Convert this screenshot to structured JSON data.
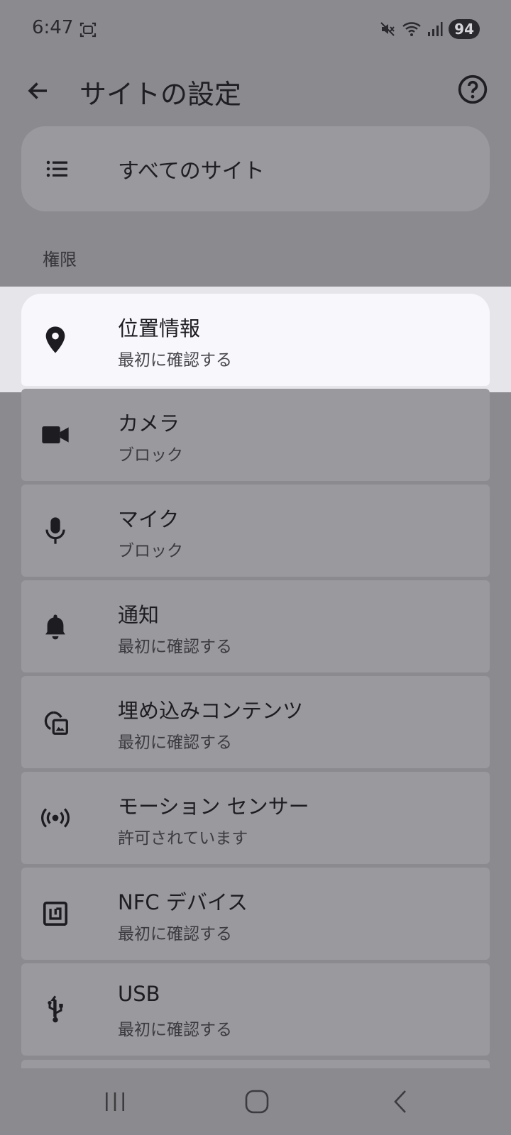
{
  "status_bar": {
    "time": "6:47",
    "battery": "94"
  },
  "app_bar": {
    "title": "サイトの設定"
  },
  "all_sites": {
    "label": "すべてのサイト"
  },
  "section": {
    "header": "権限"
  },
  "permissions": [
    {
      "title": "位置情報",
      "subtitle": "最初に確認する",
      "icon": "location-pin-icon"
    },
    {
      "title": "カメラ",
      "subtitle": "ブロック",
      "icon": "video-camera-icon"
    },
    {
      "title": "マイク",
      "subtitle": "ブロック",
      "icon": "microphone-icon"
    },
    {
      "title": "通知",
      "subtitle": "最初に確認する",
      "icon": "bell-icon"
    },
    {
      "title": "埋め込みコンテンツ",
      "subtitle": "最初に確認する",
      "icon": "embedded-content-icon"
    },
    {
      "title": "モーション センサー",
      "subtitle": "許可されています",
      "icon": "motion-sensor-icon"
    },
    {
      "title": "NFC デバイス",
      "subtitle": "最初に確認する",
      "icon": "nfc-icon"
    },
    {
      "title": "USB",
      "subtitle": "最初に確認する",
      "icon": "usb-icon"
    }
  ],
  "colors": {
    "scrim": "#8b8b8f",
    "card": "#9a9a9e",
    "highlight_card": "#f7f7fc",
    "text": "#1d1d21"
  }
}
